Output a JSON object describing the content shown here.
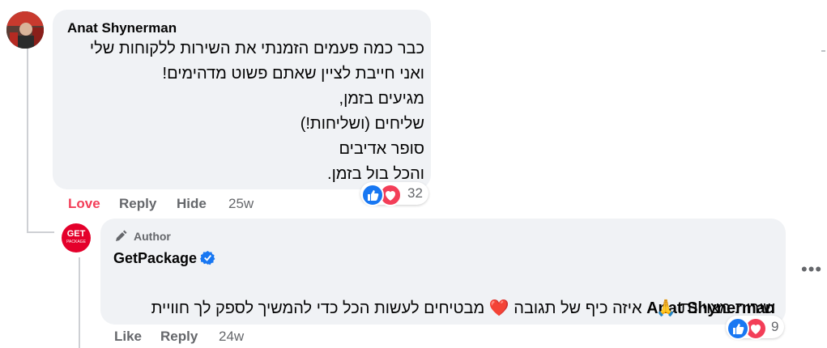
{
  "comment": {
    "author": "Anat Shynerman",
    "lines": [
      "כבר כמה פעמים הזמנתי את השירות ללקוחות שלי",
      "ואני חייבת לציין שאתם פשוט מדהימים!",
      "מגיעים בזמן,",
      "שליחים (ושליחות!)",
      "סופר אדיבים",
      "והכל בול בזמן."
    ],
    "actions": {
      "love": "Love",
      "reply": "Reply",
      "hide": "Hide",
      "time": "25w"
    },
    "reaction_count": "32"
  },
  "reply": {
    "badge": "Author",
    "author": "GetPackage",
    "avatar_text_top": "GET",
    "avatar_text_bottom": "PACKAGE",
    "mention": "Anat Shynerman",
    "line1_text": "איזה כיף של תגובה ❤️ מבטיחים לעשות הכל כדי להמשיך לספק לך חוויית",
    "line2_text": "שירות מצויינת 🙏",
    "actions": {
      "like": "Like",
      "reply": "Reply",
      "time": "24w"
    },
    "reaction_count": "9"
  },
  "colors": {
    "love": "#f33e58",
    "like_blue": "#1877f2",
    "bubble": "#f0f2f5",
    "brand_red": "#e4002b"
  }
}
